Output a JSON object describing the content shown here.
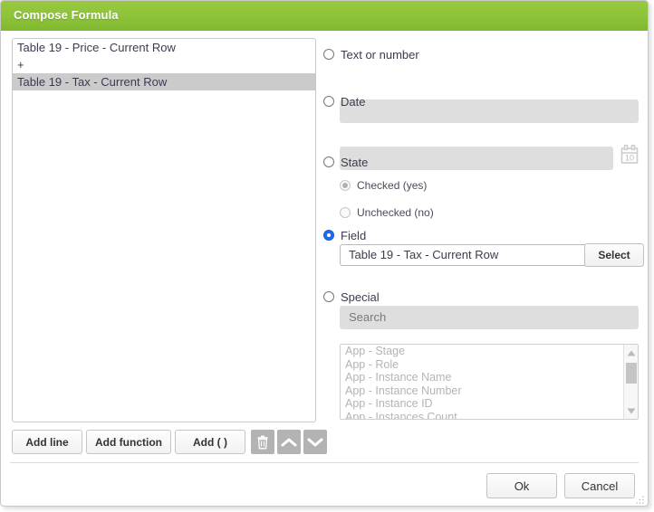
{
  "dialog": {
    "title": "Compose Formula",
    "accent_color": "#8ec33a"
  },
  "formula": {
    "lines": [
      {
        "text": "Table 19 - Price - Current Row",
        "selected": false
      },
      {
        "text": "+",
        "selected": false
      },
      {
        "text": "Table 19 - Tax - Current Row",
        "selected": true
      }
    ]
  },
  "toolbar": {
    "add_line_label": "Add line",
    "add_function_label": "Add function",
    "add_paren_label": "Add ( )",
    "delete_icon": "trash-icon",
    "move_up_icon": "chevron-up-icon",
    "move_down_icon": "chevron-down-icon"
  },
  "options": {
    "text_or_number": {
      "label": "Text or number",
      "selected": false,
      "value": "",
      "disabled": true
    },
    "date": {
      "label": "Date",
      "selected": false,
      "value": "",
      "disabled": true,
      "calendar_icon_day": "10"
    },
    "state": {
      "label": "State",
      "selected": false,
      "checked_label": "Checked (yes)",
      "unchecked_label": "Unchecked (no)",
      "checked_selected": true,
      "unchecked_selected": false
    },
    "field": {
      "label": "Field",
      "selected": true,
      "value": "Table 19 - Tax - Current Row",
      "select_button_label": "Select"
    },
    "special": {
      "label": "Special",
      "selected": false,
      "search_placeholder": "Search",
      "search_value": "",
      "items": [
        "App - Stage",
        "App - Role",
        "App - Instance Name",
        "App - Instance Number",
        "App - Instance ID",
        "App - Instances Count"
      ]
    }
  },
  "footer": {
    "ok_label": "Ok",
    "cancel_label": "Cancel"
  }
}
